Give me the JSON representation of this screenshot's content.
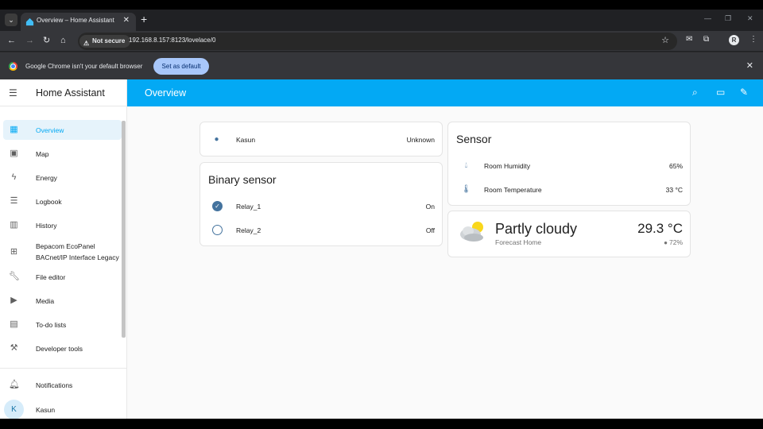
{
  "browser": {
    "tab_title": "Overview – Home Assistant",
    "tab_menu_icon": "chevron-down-icon",
    "new_tab_symbol": "+",
    "security_label": "Not secure",
    "url": "192.168.8.157:8123/lovelace/0",
    "infobar_text": "Google Chrome isn't your default browser",
    "set_default_label": "Set as default",
    "profile_initial": "R"
  },
  "sidebar": {
    "title": "Home Assistant",
    "items": [
      {
        "label": "Overview",
        "icon": "dashboard-icon",
        "active": true
      },
      {
        "label": "Map",
        "icon": "map-icon"
      },
      {
        "label": "Energy",
        "icon": "lightning-icon"
      },
      {
        "label": "Logbook",
        "icon": "list-icon"
      },
      {
        "label": "History",
        "icon": "chart-icon"
      },
      {
        "label": "Bepacom EcoPanel",
        "label_line2": "BACnet/IP Interface Legacy",
        "icon": "ethernet-icon"
      },
      {
        "label": "File editor",
        "icon": "wrench-icon"
      },
      {
        "label": "Media",
        "icon": "media-icon"
      },
      {
        "label": "To-do lists",
        "icon": "clipboard-icon"
      },
      {
        "label": "Developer tools",
        "icon": "hammer-icon"
      }
    ],
    "notifications_label": "Notifications",
    "user_name": "Kasun",
    "user_initial": "K"
  },
  "header": {
    "title": "Overview"
  },
  "cards": {
    "person": {
      "name": "Kasun",
      "state": "Unknown"
    },
    "binary_sensor": {
      "title": "Binary sensor",
      "rows": [
        {
          "name": "Relay_1",
          "state": "On"
        },
        {
          "name": "Relay_2",
          "state": "Off"
        }
      ]
    },
    "sensor": {
      "title": "Sensor",
      "rows": [
        {
          "name": "Room Humidity",
          "value": "65%"
        },
        {
          "name": "Room Temperature",
          "value": "33 °C"
        }
      ]
    },
    "weather": {
      "condition": "Partly cloudy",
      "name": "Forecast Home",
      "temperature": "29.3 °C",
      "humidity": "72%"
    }
  },
  "colors": {
    "accent": "#03a9f4",
    "icon": "#44739e"
  }
}
